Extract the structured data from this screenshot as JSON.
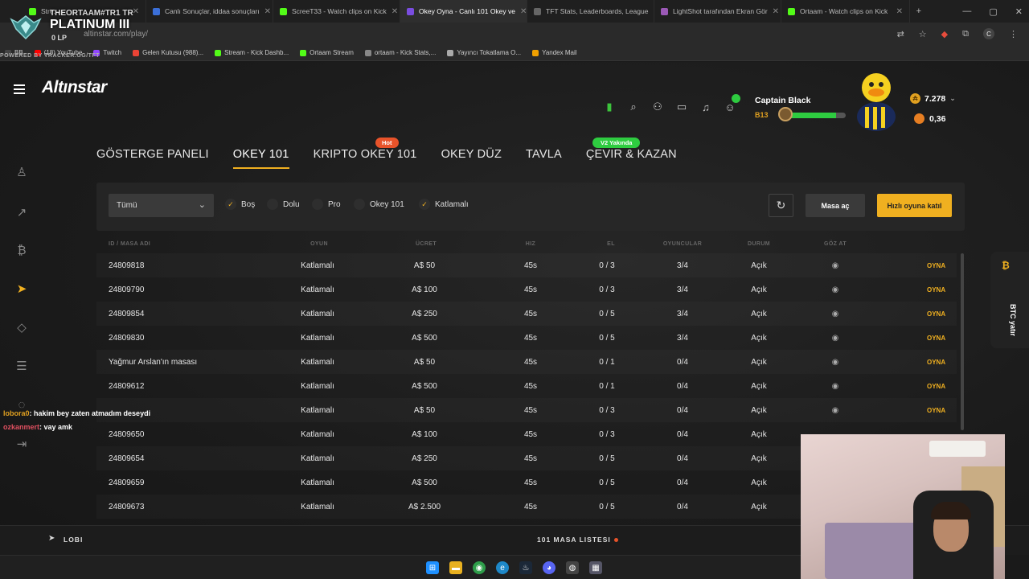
{
  "browser": {
    "tabs": [
      {
        "title": "Stre...",
        "color": "#53fc18"
      },
      {
        "title": "Canlı Sonuçlar, iddaa sonuçları",
        "color": "#3b6fd8"
      },
      {
        "title": "ScreeT33 - Watch clips on Kick",
        "color": "#53fc18"
      },
      {
        "title": "Okey Oyna - Canlı 101 Okey ve",
        "color": "#7a4de0",
        "active": true
      },
      {
        "title": "TFT Stats, Leaderboards, League",
        "color": "#666666"
      },
      {
        "title": "LightShot tarafından Ekran Gör",
        "color": "#9b59b6"
      },
      {
        "title": "Ortaam - Watch clips on Kick",
        "color": "#53fc18"
      }
    ],
    "url": "altinstar.com/play/",
    "bookmarks": [
      {
        "label": "BB",
        "color": "#444444"
      },
      {
        "label": "(18) YouTube",
        "color": "#ff0000"
      },
      {
        "label": "Twitch",
        "color": "#9146ff"
      },
      {
        "label": "Gelen Kutusu (988)...",
        "color": "#ea4335"
      },
      {
        "label": "Stream - Kick Dashb...",
        "color": "#53fc18"
      },
      {
        "label": "Ortaam Stream",
        "color": "#53fc18"
      },
      {
        "label": "ortaam - Kick Stats,...",
        "color": "#888888"
      },
      {
        "label": "Yayıncı Tokatlama O...",
        "color": "#aaaaaa"
      },
      {
        "label": "Yandex Mail",
        "color": "#f0a000"
      }
    ],
    "profile_letter": "C"
  },
  "overlay": {
    "user": "THEORTAAM#TR1 TR",
    "rank": "PLATINUM III",
    "lp": "0 LP",
    "powered": "POWERED BY TRACKER.GG/TFT"
  },
  "site": {
    "logo": "Altınstar",
    "user": {
      "name": "Captain Black",
      "level": "B13",
      "xp_fraction": 0.85
    },
    "balance": {
      "primary": "7.278",
      "secondary": "0,36"
    },
    "nav": [
      {
        "label": "GÖSTERGE PANELI"
      },
      {
        "label": "OKEY 101",
        "active": true
      },
      {
        "label": "KRIPTO OKEY 101"
      },
      {
        "label": "OKEY DÜZ"
      },
      {
        "label": "TAVLA"
      },
      {
        "label": "ÇEVIR & KAZAN"
      }
    ],
    "pill_hot": "Hot",
    "pill_v2": "V2 Yakında",
    "filter": {
      "select_value": "Tümü",
      "checks": [
        {
          "label": "Boş",
          "checked": true
        },
        {
          "label": "Dolu",
          "checked": false
        },
        {
          "label": "Pro",
          "checked": false
        },
        {
          "label": "Okey 101",
          "checked": false
        },
        {
          "label": "Katlamalı",
          "checked": true
        }
      ],
      "masa_ac": "Masa aç",
      "hizli": "Hızlı oyuna katıl"
    },
    "table": {
      "headers": [
        "ID / MASA ADI",
        "OYUN",
        "ÜCRET",
        "HIZ",
        "EL",
        "OYUNCULAR",
        "DURUM",
        "GÖZ AT"
      ],
      "rows": [
        {
          "id": "24809818",
          "oyun": "Katlamalı",
          "ucret": "A$  50",
          "hiz": "45s",
          "el": "0 / 3",
          "oyuncular": "3/4",
          "durum": "Açık",
          "eye": true,
          "action": "OYNA"
        },
        {
          "id": "24809790",
          "oyun": "Katlamalı",
          "ucret": "A$  100",
          "hiz": "45s",
          "el": "0 / 3",
          "oyuncular": "3/4",
          "durum": "Açık",
          "eye": true,
          "action": "OYNA"
        },
        {
          "id": "24809854",
          "oyun": "Katlamalı",
          "ucret": "A$  250",
          "hiz": "45s",
          "el": "0 / 5",
          "oyuncular": "3/4",
          "durum": "Açık",
          "eye": true,
          "action": "OYNA"
        },
        {
          "id": "24809830",
          "oyun": "Katlamalı",
          "ucret": "A$  500",
          "hiz": "45s",
          "el": "0 / 5",
          "oyuncular": "3/4",
          "durum": "Açık",
          "eye": true,
          "action": "OYNA"
        },
        {
          "id": "Yağmur Arslan'ın masası",
          "oyun": "Katlamalı",
          "ucret": "A$  50",
          "hiz": "45s",
          "el": "0 / 1",
          "oyuncular": "0/4",
          "durum": "Açık",
          "eye": true,
          "action": "OYNA"
        },
        {
          "id": "24809612",
          "oyun": "Katlamalı",
          "ucret": "A$  500",
          "hiz": "45s",
          "el": "0 / 1",
          "oyuncular": "0/4",
          "durum": "Açık",
          "eye": true,
          "action": "OYNA"
        },
        {
          "id": "",
          "oyun": "Katlamalı",
          "ucret": "A$  50",
          "hiz": "45s",
          "el": "0 / 3",
          "oyuncular": "0/4",
          "durum": "Açık",
          "eye": true,
          "action": "OYNA"
        },
        {
          "id": "24809650",
          "oyun": "Katlamalı",
          "ucret": "A$  100",
          "hiz": "45s",
          "el": "0 / 3",
          "oyuncular": "0/4",
          "durum": "Açık",
          "eye": false,
          "action": ""
        },
        {
          "id": "24809654",
          "oyun": "Katlamalı",
          "ucret": "A$  250",
          "hiz": "45s",
          "el": "0 / 5",
          "oyuncular": "0/4",
          "durum": "Açık",
          "eye": false,
          "action": ""
        },
        {
          "id": "24809659",
          "oyun": "Katlamalı",
          "ucret": "A$  500",
          "hiz": "45s",
          "el": "0 / 5",
          "oyuncular": "0/4",
          "durum": "Açık",
          "eye": false,
          "action": ""
        },
        {
          "id": "24809673",
          "oyun": "Katlamalı",
          "ucret": "A$  2.500",
          "hiz": "45s",
          "el": "0 / 5",
          "oyuncular": "0/4",
          "durum": "Açık",
          "eye": false,
          "action": ""
        }
      ]
    },
    "btc_tab": "BTC yatır",
    "bottom": {
      "lobi": "LOBI",
      "masa_list": "101 MASA LISTESI"
    }
  },
  "chat": [
    {
      "user": "lobora0",
      "message": ": hakim bey zaten atmadım deseydi"
    },
    {
      "user": "ozkanmert",
      "message": ": vay amk"
    }
  ],
  "colors": {
    "accent": "#f0b020",
    "green": "#2ecc40",
    "hot": "#e8532a"
  }
}
